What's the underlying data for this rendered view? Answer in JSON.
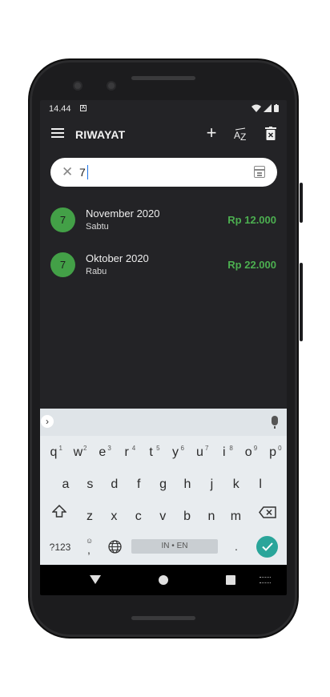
{
  "status": {
    "time": "14.44",
    "notif": "A"
  },
  "appbar": {
    "title": "RIWAYAT",
    "sort_label": "AZ"
  },
  "search": {
    "value": "7",
    "placeholder": ""
  },
  "items": [
    {
      "badge": "7",
      "month": "November 2020",
      "day": "Sabtu",
      "amount": "Rp  12.000"
    },
    {
      "badge": "7",
      "month": "Oktober 2020",
      "day": "Rabu",
      "amount": "Rp  22.000"
    }
  ],
  "keyboard": {
    "row1": [
      "q",
      "w",
      "e",
      "r",
      "t",
      "y",
      "u",
      "i",
      "o",
      "p"
    ],
    "row1_hints": [
      "1",
      "2",
      "3",
      "4",
      "5",
      "6",
      "7",
      "8",
      "9",
      "0"
    ],
    "row2": [
      "a",
      "s",
      "d",
      "f",
      "g",
      "h",
      "j",
      "k",
      "l"
    ],
    "row3": [
      "z",
      "x",
      "c",
      "v",
      "b",
      "n",
      "m"
    ],
    "symbols_label": "?123",
    "comma_label": ",",
    "period_label": ".",
    "space_label": "IN • EN"
  },
  "colors": {
    "accent": "#4caf50",
    "badge": "#43a047",
    "done": "#2aa59a",
    "screen_bg": "#232326"
  },
  "icons": {
    "menu": "menu-icon",
    "add": "plus-icon",
    "sort": "sort-az-icon",
    "delete": "trash-icon",
    "clear": "close-icon",
    "calendar": "calendar-icon"
  }
}
